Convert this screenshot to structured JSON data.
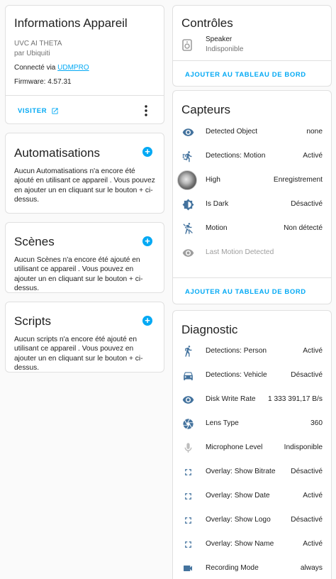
{
  "device_info": {
    "title": "Informations Appareil",
    "model": "UVC AI THETA",
    "manufacturer": "par Ubiquiti",
    "connected_prefix": "Connecté via ",
    "connected_link": "UDMPRO",
    "firmware": "Firmware: 4.57.31",
    "visit_label": "VISITER"
  },
  "automations": {
    "title": "Automatisations",
    "text": "Aucun Automatisations n'a encore été ajouté en utilisant ce appareil . Vous pouvez en ajouter un en cliquant sur le bouton + ci-dessus."
  },
  "scenes": {
    "title": "Scènes",
    "text": "Aucun Scènes n'a encore été ajouté en utilisant ce appareil . Vous pouvez en ajouter un en cliquant sur le bouton + ci-dessus."
  },
  "scripts": {
    "title": "Scripts",
    "text": "Aucun scripts n'a encore été ajouté en utilisant ce appareil . Vous pouvez en ajouter un en cliquant sur le bouton + ci-dessus."
  },
  "controls": {
    "title": "Contrôles",
    "speaker_name": "Speaker",
    "speaker_state": "Indisponible",
    "add_label": "AJOUTER AU TABLEAU DE BORD"
  },
  "sensors": {
    "title": "Capteurs",
    "add_label": "AJOUTER AU TABLEAU DE BORD",
    "rows": [
      {
        "name": "Detected Object",
        "value": "none",
        "icon": "eye-icon"
      },
      {
        "name": "Detections: Motion",
        "value": "Activé",
        "icon": "motion-run-icon"
      },
      {
        "name": "High",
        "value": "Enregistrement",
        "icon": "camera-thumbnail"
      },
      {
        "name": "Is Dark",
        "value": "Désactivé",
        "icon": "brightness-icon"
      },
      {
        "name": "Motion",
        "value": "Non détecté",
        "icon": "walk-off-icon"
      },
      {
        "name": "Last Motion Detected",
        "value": "",
        "icon": "eye-icon"
      }
    ]
  },
  "diagnostic": {
    "title": "Diagnostic",
    "rows": [
      {
        "name": "Detections: Person",
        "value": "Activé",
        "icon": "walk-icon"
      },
      {
        "name": "Detections: Vehicle",
        "value": "Désactivé",
        "icon": "car-icon"
      },
      {
        "name": "Disk Write Rate",
        "value": "1 333 391,17 B/s",
        "icon": "eye-icon"
      },
      {
        "name": "Lens Type",
        "value": "360",
        "icon": "aperture-icon"
      },
      {
        "name": "Microphone Level",
        "value": "Indisponible",
        "icon": "microphone-icon"
      },
      {
        "name": "Overlay: Show Bitrate",
        "value": "Désactivé",
        "icon": "fullscreen-icon"
      },
      {
        "name": "Overlay: Show Date",
        "value": "Activé",
        "icon": "fullscreen-icon"
      },
      {
        "name": "Overlay: Show Logo",
        "value": "Désactivé",
        "icon": "fullscreen-icon"
      },
      {
        "name": "Overlay: Show Name",
        "value": "Activé",
        "icon": "fullscreen-icon"
      },
      {
        "name": "Recording Mode",
        "value": "always",
        "icon": "video-icon"
      }
    ]
  },
  "colors": {
    "accent": "#03a9f4",
    "icon": "#44739e",
    "disabled": "#9e9e9e"
  }
}
